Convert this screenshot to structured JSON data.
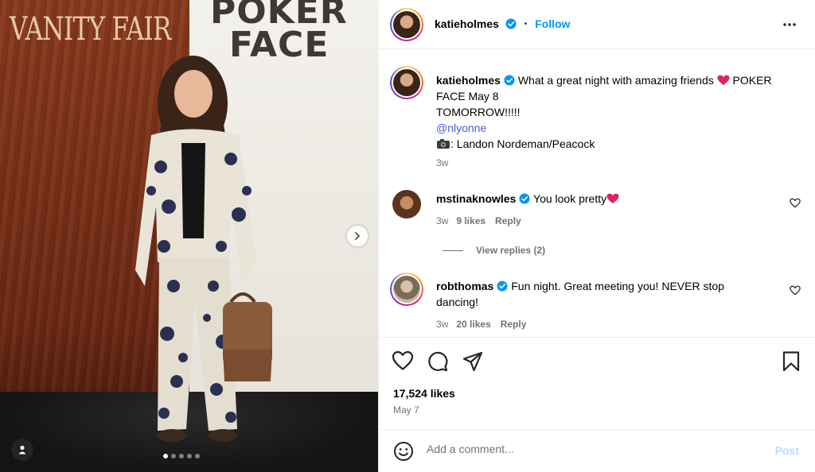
{
  "media": {
    "backdrop_logo": "VANITY FAIR",
    "poster_line1": "POKER",
    "poster_line2": "FACE",
    "carousel_dots": 5,
    "active_dot": 0,
    "next_icon": "chevron-right-icon",
    "tag_icon": "user-tag-icon"
  },
  "header": {
    "username": "katieholmes",
    "follow_label": "Follow",
    "bullet": "•",
    "more_icon": "more-options-icon"
  },
  "caption": {
    "username": "katieholmes",
    "text_line1": "What a great night with amazing friends",
    "text_line1b": "POKER",
    "text_line2": "FACE May 8",
    "text_line3": "TOMORROW!!!!!",
    "mention": "@nlyonne",
    "credit": ": Landon Nordeman/Peacock",
    "time": "3w"
  },
  "comments": [
    {
      "username": "mstinaknowles",
      "text": "You look pretty",
      "time": "3w",
      "likes": "9 likes",
      "reply_label": "Reply"
    },
    {
      "username": "robthomas",
      "text_line1": "Fun night. Great meeting you! NEVER stop",
      "text_line2": "dancing!",
      "time": "3w",
      "likes": "20 likes",
      "reply_label": "Reply"
    }
  ],
  "view_replies": "View replies (2)",
  "stats": {
    "likes": "17,524 likes",
    "date": "May 7"
  },
  "composer": {
    "placeholder": "Add a comment...",
    "post_label": "Post"
  },
  "colors": {
    "accent": "#0095f6",
    "post_disabled": "#b2dffc",
    "heart_emoji": "#e0245e",
    "muted": "#737373"
  }
}
